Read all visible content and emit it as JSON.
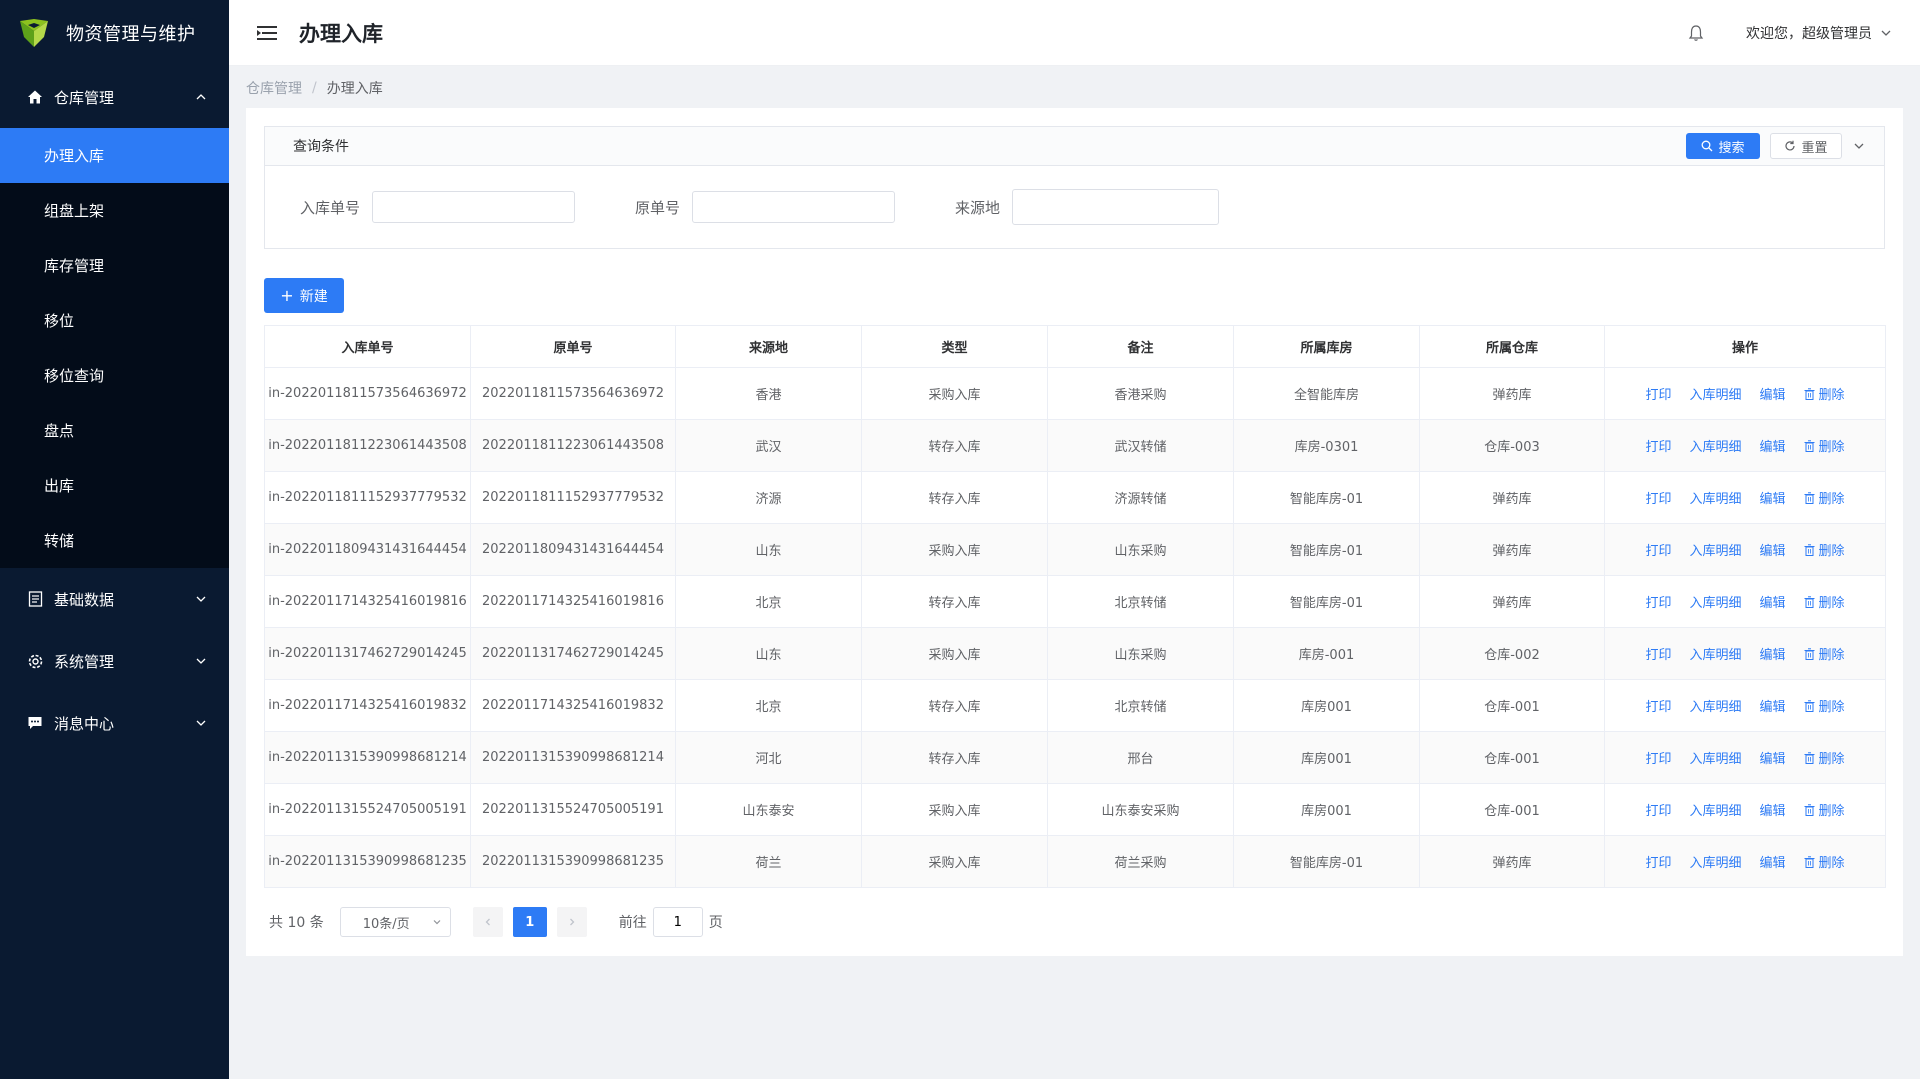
{
  "app": {
    "title": "物资管理与维护",
    "accent": "#2d7bf5",
    "sidebar_bg": "#0a1a31"
  },
  "sidebar": {
    "groups": [
      {
        "label": "仓库管理",
        "icon": "home-icon",
        "expanded": true,
        "items": [
          {
            "label": "办理入库",
            "active": true
          },
          {
            "label": "组盘上架"
          },
          {
            "label": "库存管理"
          },
          {
            "label": "移位"
          },
          {
            "label": "移位查询"
          },
          {
            "label": "盘点"
          },
          {
            "label": "出库"
          },
          {
            "label": "转储"
          }
        ]
      },
      {
        "label": "基础数据",
        "icon": "document-icon",
        "expanded": false
      },
      {
        "label": "系统管理",
        "icon": "gear-icon",
        "expanded": false
      },
      {
        "label": "消息中心",
        "icon": "message-icon",
        "expanded": false
      }
    ]
  },
  "header": {
    "title": "办理入库",
    "welcome": "欢迎您，超级管理员"
  },
  "breadcrumb": {
    "parent": "仓库管理",
    "separator": "/",
    "current": "办理入库"
  },
  "query": {
    "title": "查询条件",
    "search_label": "搜索",
    "reset_label": "重置",
    "fields": [
      {
        "label": "入库单号",
        "value": ""
      },
      {
        "label": "原单号",
        "value": ""
      },
      {
        "label": "来源地",
        "value": ""
      }
    ]
  },
  "toolbar": {
    "new_label": "新建"
  },
  "table": {
    "columns": [
      "入库单号",
      "原单号",
      "来源地",
      "类型",
      "备注",
      "所属库房",
      "所属仓库",
      "操作"
    ],
    "actions": {
      "print": "打印",
      "detail": "入库明细",
      "edit": "编辑",
      "delete": "删除"
    },
    "rows": [
      [
        "in-2022011811573564636972",
        "2022011811573564636972",
        "香港",
        "采购入库",
        "香港采购",
        "全智能库房",
        "弹药库"
      ],
      [
        "in-2022011811223061443508",
        "2022011811223061443508",
        "武汉",
        "转存入库",
        "武汉转储",
        "库房-0301",
        "仓库-003"
      ],
      [
        "in-2022011811152937779532",
        "2022011811152937779532",
        "济源",
        "转存入库",
        "济源转储",
        "智能库房-01",
        "弹药库"
      ],
      [
        "in-2022011809431431644454",
        "2022011809431431644454",
        "山东",
        "采购入库",
        "山东采购",
        "智能库房-01",
        "弹药库"
      ],
      [
        "in-2022011714325416019816",
        "2022011714325416019816",
        "北京",
        "转存入库",
        "北京转储",
        "智能库房-01",
        "弹药库"
      ],
      [
        "in-2022011317462729014245",
        "2022011317462729014245",
        "山东",
        "采购入库",
        "山东采购",
        "库房-001",
        "仓库-002"
      ],
      [
        "in-2022011714325416019832",
        "2022011714325416019832",
        "北京",
        "转存入库",
        "北京转储",
        "库房001",
        "仓库-001"
      ],
      [
        "in-2022011315390998681214",
        "2022011315390998681214",
        "河北",
        "转存入库",
        "邢台",
        "库房001",
        "仓库-001"
      ],
      [
        "in-2022011315524705005191",
        "2022011315524705005191",
        "山东泰安",
        "采购入库",
        "山东泰安采购",
        "库房001",
        "仓库-001"
      ],
      [
        "in-2022011315390998681235",
        "2022011315390998681235",
        "荷兰",
        "采购入库",
        "荷兰采购",
        "智能库房-01",
        "弹药库"
      ]
    ]
  },
  "pager": {
    "total_text": "共 10 条",
    "page_size": "10条/页",
    "current_page": "1",
    "goto_label": "前往",
    "goto_value": "1",
    "goto_suffix": "页"
  }
}
